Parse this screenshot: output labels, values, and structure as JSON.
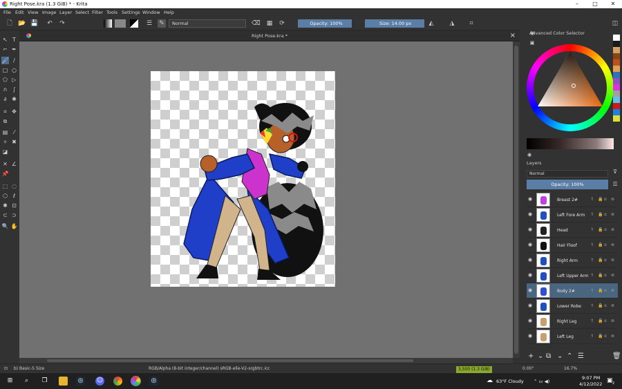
{
  "window": {
    "title": "Right Pose.kra (1.3 GiB)  * - Krita",
    "controls": [
      "–",
      "□",
      "✕"
    ]
  },
  "menu": [
    "File",
    "Edit",
    "View",
    "Image",
    "Layer",
    "Select",
    "Filter",
    "Tools",
    "Settings",
    "Window",
    "Help"
  ],
  "toolbar": {
    "blend_mode": "Normal",
    "opacity": "Opacity: 100%",
    "size": "Size: 14.00 px"
  },
  "document": {
    "tab_title": "Right Pose.kra *"
  },
  "dock": {
    "color_panel_title": "Advanced Color Selector",
    "palette_colors": [
      "#ffffff",
      "#1a1a1a",
      "#d9a066",
      "#8b4513",
      "#c05020",
      "#e0a050",
      "#3070c0",
      "#9050c0",
      "#e030e0",
      "#a0a0a0",
      "#60c0f0",
      "#d01818",
      "#2080e0",
      "#e0e030"
    ],
    "layers_title": "Layers",
    "layer_blend": "Normal",
    "layer_opacity": "Opacity:  100%",
    "layers": [
      {
        "name": "Breast 2#",
        "thumb": "#c040e0",
        "selected": false
      },
      {
        "name": "Left Fore Arm",
        "thumb": "#2050c0",
        "selected": false
      },
      {
        "name": "Head",
        "thumb": "#222222",
        "selected": false
      },
      {
        "name": "Hair Floof",
        "thumb": "#111111",
        "selected": false
      },
      {
        "name": "Right Arm",
        "thumb": "#2050c0",
        "selected": false
      },
      {
        "name": "Left Upper Arm",
        "thumb": "#2050c0",
        "selected": false
      },
      {
        "name": "Body 2#",
        "thumb": "#3050d0",
        "selected": true
      },
      {
        "name": "Lower Robe",
        "thumb": "#2050c0",
        "selected": false
      },
      {
        "name": "Right Leg",
        "thumb": "#c8a070",
        "selected": false
      },
      {
        "name": "Left Leg",
        "thumb": "#c8a070",
        "selected": false
      }
    ]
  },
  "status": {
    "brush": "b) Basic-5 Size",
    "color_space": "RGB/Alpha (8-bit integer/channel)  sRGB-elle-V2-srgbtrc.icc",
    "memory": "3,500 (1.3 GiB)",
    "rotation": "0.00°",
    "zoom": "16.7%"
  },
  "taskbar": {
    "weather": "63°F  Cloudy",
    "time": "9:07 PM",
    "date": "4/12/2022",
    "notification_count": "2"
  }
}
